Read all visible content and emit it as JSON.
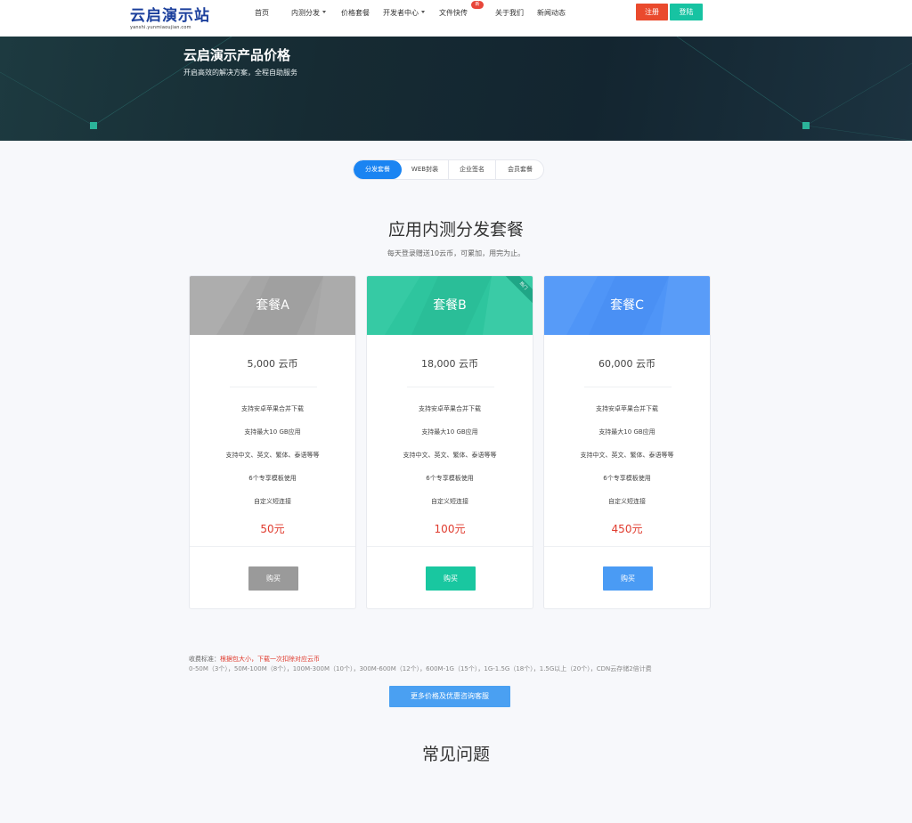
{
  "header": {
    "logo_main": "云启演示站",
    "logo_sub": "yanshi.yunmiaoujian.com",
    "nav": [
      {
        "label": "首页",
        "dropdown": false
      },
      {
        "label": "内测分发",
        "dropdown": true
      },
      {
        "label": "价格套餐",
        "dropdown": false
      },
      {
        "label": "开发者中心",
        "dropdown": true
      },
      {
        "label": "文件快传",
        "dropdown": false
      },
      {
        "label": "关于我们",
        "dropdown": false
      },
      {
        "label": "新闻动态",
        "dropdown": false
      }
    ],
    "new_badge": "新",
    "register_label": "注册",
    "login_label": "登陆"
  },
  "banner": {
    "title": "云启演示产品价格",
    "subtitle": "开启高效的解决方案，全程自助服务"
  },
  "tabs": [
    {
      "label": "分发套餐",
      "active": true
    },
    {
      "label": "WEB封装",
      "active": false
    },
    {
      "label": "企业签名",
      "active": false
    },
    {
      "label": "会员套餐",
      "active": false
    }
  ],
  "section": {
    "title": "应用内测分发套餐",
    "subtitle": "每天登录赠送10云币，可累加，用完为止。"
  },
  "plans": [
    {
      "name": "套餐A",
      "coins": "5,000 云币",
      "features": [
        "支持安卓苹果合并下载",
        "支持最大10 GB应用",
        "支持中文、英文、繁体、泰语等等",
        "6个专享模板使用",
        "自定义短连接"
      ],
      "price": "50元",
      "buy_label": "购买",
      "color": "#a6a6a6",
      "button_color": "#9a9a9a",
      "ribbon": ""
    },
    {
      "name": "套餐B",
      "coins": "18,000 云币",
      "features": [
        "支持安卓苹果合并下载",
        "支持最大10 GB应用",
        "支持中文、英文、繁体、泰语等等",
        "6个专享模板使用",
        "自定义短连接"
      ],
      "price": "100元",
      "buy_label": "购买",
      "color": "#2ec59e",
      "button_color": "#19c7a0",
      "ribbon": "热门"
    },
    {
      "name": "套餐C",
      "coins": "60,000 云币",
      "features": [
        "支持安卓苹果合并下载",
        "支持最大10 GB应用",
        "支持中文、英文、繁体、泰语等等",
        "6个专享模板使用",
        "自定义短连接"
      ],
      "price": "450元",
      "buy_label": "购买",
      "color": "#4f95f7",
      "button_color": "#4a9bf4",
      "ribbon": ""
    }
  ],
  "fees": {
    "label": "收费标准：",
    "highlight": "根据包大小，下载一次扣除对应云币",
    "tiers": "0-50M（3个），50M-100M（8个），100M-300M（10个），300M-600M（12个），600M-1G（15个），1G-1.5G（18个），1.5G以上（20个），CDN云存储2倍计费"
  },
  "consult_label": "更多价格及优惠咨询客服",
  "faq_title": "常见问题"
}
